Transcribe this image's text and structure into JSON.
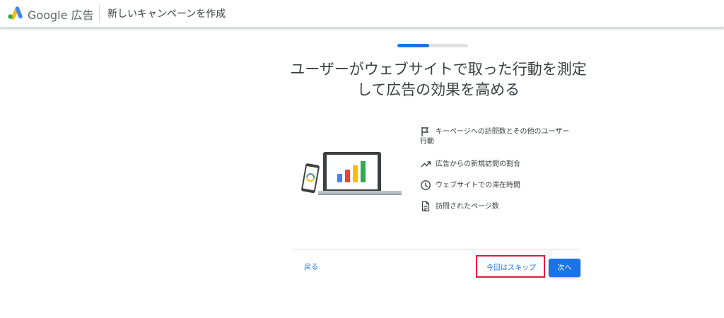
{
  "header": {
    "brand_name": "Google 広告",
    "page_title": "新しいキャンペーンを作成"
  },
  "progress": {
    "fraction": 0.45
  },
  "main": {
    "headline_line1": "ユーザーがウェブサイトで取った行動を測定",
    "headline_line2": "して広告の効果を高める",
    "features": [
      {
        "icon": "flag-icon",
        "label": "キーページへの訪問数とその他のユーザー行動"
      },
      {
        "icon": "trending-up-icon",
        "label": "広告からの新規訪問の割合"
      },
      {
        "icon": "clock-icon",
        "label": "ウェブサイトでの滞在時間"
      },
      {
        "icon": "document-icon",
        "label": "訪問されたページ数"
      }
    ]
  },
  "footer": {
    "back_label": "戻る",
    "skip_label": "今回はスキップ",
    "next_label": "次へ"
  },
  "colors": {
    "accent": "#1a73e8",
    "highlight": "#e8173a",
    "bar_colors": [
      "#4285f4",
      "#ea4335",
      "#fbbc04",
      "#34a853"
    ]
  }
}
